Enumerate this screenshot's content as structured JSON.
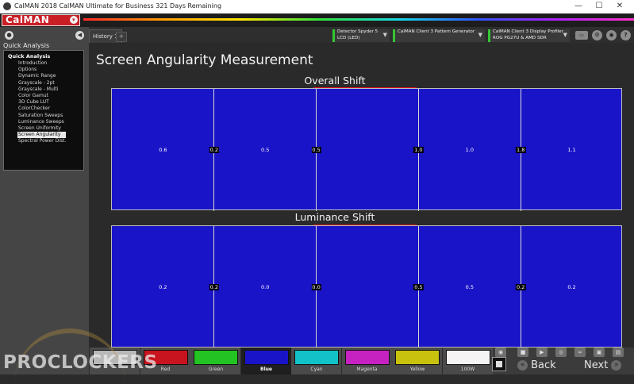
{
  "window": {
    "title": "CalMAN 2018 CalMAN Ultimate for Business 321 Days Remaining",
    "minimize_glyph": "—",
    "maximize_glyph": "☐",
    "close_glyph": "✕"
  },
  "brand": {
    "logo": "CalMAN",
    "dropdown_glyph": "▾"
  },
  "sidebar": {
    "header": "Quick Analysis",
    "group": "Quick Analysis",
    "items": [
      {
        "label": "Introduction"
      },
      {
        "label": "Options"
      },
      {
        "label": "Dynamic Range"
      },
      {
        "label": "Grayscale - 2pt"
      },
      {
        "label": "Grayscale - Multi"
      },
      {
        "label": "Color Gamut"
      },
      {
        "label": "3D Cube LUT"
      },
      {
        "label": "ColorChecker"
      },
      {
        "label": "Saturation Sweeps"
      },
      {
        "label": "Luminance Sweeps"
      },
      {
        "label": "Screen Uniformity"
      },
      {
        "label": "Screen Angularity"
      },
      {
        "label": "Spectral Power Dist."
      }
    ],
    "selected_index": 11
  },
  "tabs": {
    "history": "History 1",
    "add": "+"
  },
  "devices": {
    "meter": {
      "line1": "Detector Spyder 5",
      "line2": "LCD (LED)"
    },
    "generator": {
      "line1": "CalMAN Client 3 Pattern Generator",
      "line2": ""
    },
    "display": {
      "line1": "CalMAN Client 3 Display Profiler",
      "line2": "ROG PG27U & AMD SDR"
    }
  },
  "page": {
    "title": "Screen Angularity Measurement",
    "overall": {
      "title": "Overall Shift",
      "cell_values": [
        "0.6",
        "0.5",
        "1.0",
        "1.1"
      ],
      "boundary_values": [
        "0.2",
        "0.5",
        "1.0",
        "1.8"
      ]
    },
    "luminance": {
      "title": "Luminance Shift",
      "cell_values": [
        "0.2",
        "0.0",
        "0.5",
        "0.2"
      ],
      "boundary_values": [
        "0.2",
        "0.0",
        "0.5",
        "0.2"
      ]
    }
  },
  "bottom": {
    "swatches": [
      {
        "label": "",
        "color": "#b8b8b8"
      },
      {
        "label": "Red",
        "color": "#c8141e"
      },
      {
        "label": "Green",
        "color": "#22c322"
      },
      {
        "label": "Blue",
        "color": "#1a14c8"
      },
      {
        "label": "Cyan",
        "color": "#12c2c8"
      },
      {
        "label": "Magenta",
        "color": "#c622c2"
      },
      {
        "label": "Yellow",
        "color": "#c8c20e"
      },
      {
        "label": "100W",
        "color": "#f4f4f4"
      }
    ],
    "selected_swatch": 3,
    "back": "Back",
    "next": "Next"
  },
  "watermark": "PROCLOCKERS",
  "colors": {
    "chart_fill": "#1a14c8",
    "accent": "#c81e24"
  }
}
